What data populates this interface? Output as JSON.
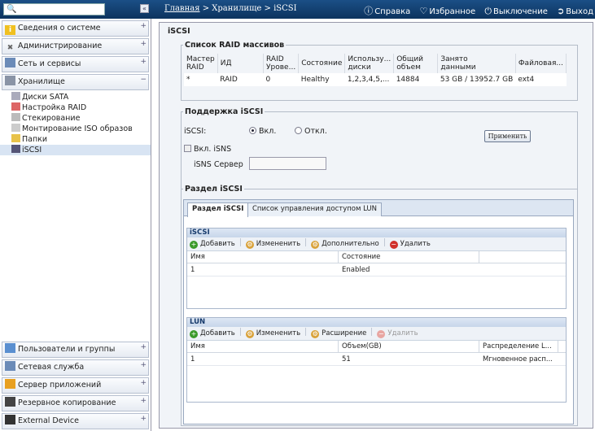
{
  "topbar": {
    "search_placeholder": "",
    "collapse": "«",
    "breadcrumb_home": "Главная",
    "breadcrumb_sep1": " > ",
    "breadcrumb_storage": "Хранилище",
    "breadcrumb_sep2": " > ",
    "breadcrumb_current": "iSCSI",
    "help": "Справка",
    "favorites": "Избранное",
    "shutdown": "Выключение",
    "logout": "Выход"
  },
  "sidebar": {
    "items": [
      {
        "label": "Сведения о системе",
        "icon": "info-icon"
      },
      {
        "label": "Администрирование",
        "icon": "tools-icon"
      },
      {
        "label": "Сеть и сервисы",
        "icon": "network-icon"
      },
      {
        "label": "Хранилище",
        "icon": "storage-icon"
      }
    ],
    "storage_sub": [
      {
        "label": "Диски SATA"
      },
      {
        "label": "Настройка RAID"
      },
      {
        "label": "Стекирование"
      },
      {
        "label": "Монтирование ISO образов"
      },
      {
        "label": "Папки"
      },
      {
        "label": "iSCSI"
      }
    ],
    "bottom_items": [
      {
        "label": "Пользователи и группы"
      },
      {
        "label": "Сетевая служба"
      },
      {
        "label": "Сервер приложений"
      },
      {
        "label": "Резервное копирование"
      },
      {
        "label": "External Device"
      }
    ]
  },
  "main": {
    "title": "iSCSI",
    "raid": {
      "legend": "Список RAID массивов",
      "headers": [
        "Мастер\nRAID",
        "ИД",
        "RAID\nУрове...",
        "Состояние",
        "Использу...\nдиски",
        "Общий\nобъем",
        "Занято\nданными",
        "Файловая..."
      ],
      "row": [
        "*",
        "RAID",
        "0",
        "Healthy",
        "1,2,3,4,5,...",
        "14884",
        "53 GB / 13952.7 GB",
        "ext4"
      ]
    },
    "support": {
      "legend": "Поддержка iSCSI",
      "iscsi_label": "iSCSI:",
      "on": "Вкл.",
      "off": "Откл.",
      "apply": "Применить",
      "isns_check": "Вкл. iSNS",
      "isns_server": "iSNS Сервер",
      "isns_value": ""
    },
    "section": {
      "legend": "Раздел iSCSI",
      "tabs": [
        "Раздел iSCSI",
        "Список управления доступом LUN"
      ],
      "iscsi_grid": {
        "title": "iSCSI",
        "toolbar": [
          "Добавить",
          "Измененить",
          "Дополнительно",
          "Удалить"
        ],
        "headers": [
          "Имя",
          "Состояние"
        ],
        "row": [
          "1",
          "Enabled"
        ]
      },
      "lun_grid": {
        "title": "LUN",
        "toolbar": [
          "Добавить",
          "Измененить",
          "Расширение",
          "Удалить"
        ],
        "headers": [
          "Имя",
          "Объем(GB)",
          "Распределение L..."
        ],
        "row": [
          "1",
          "51",
          "Мгновенное расп..."
        ]
      }
    }
  },
  "colors": {
    "topbar": "#0f3d6e",
    "accent_add": "#3a9a2a",
    "accent_delete": "#d0302a",
    "edit": "#d9a23a"
  }
}
